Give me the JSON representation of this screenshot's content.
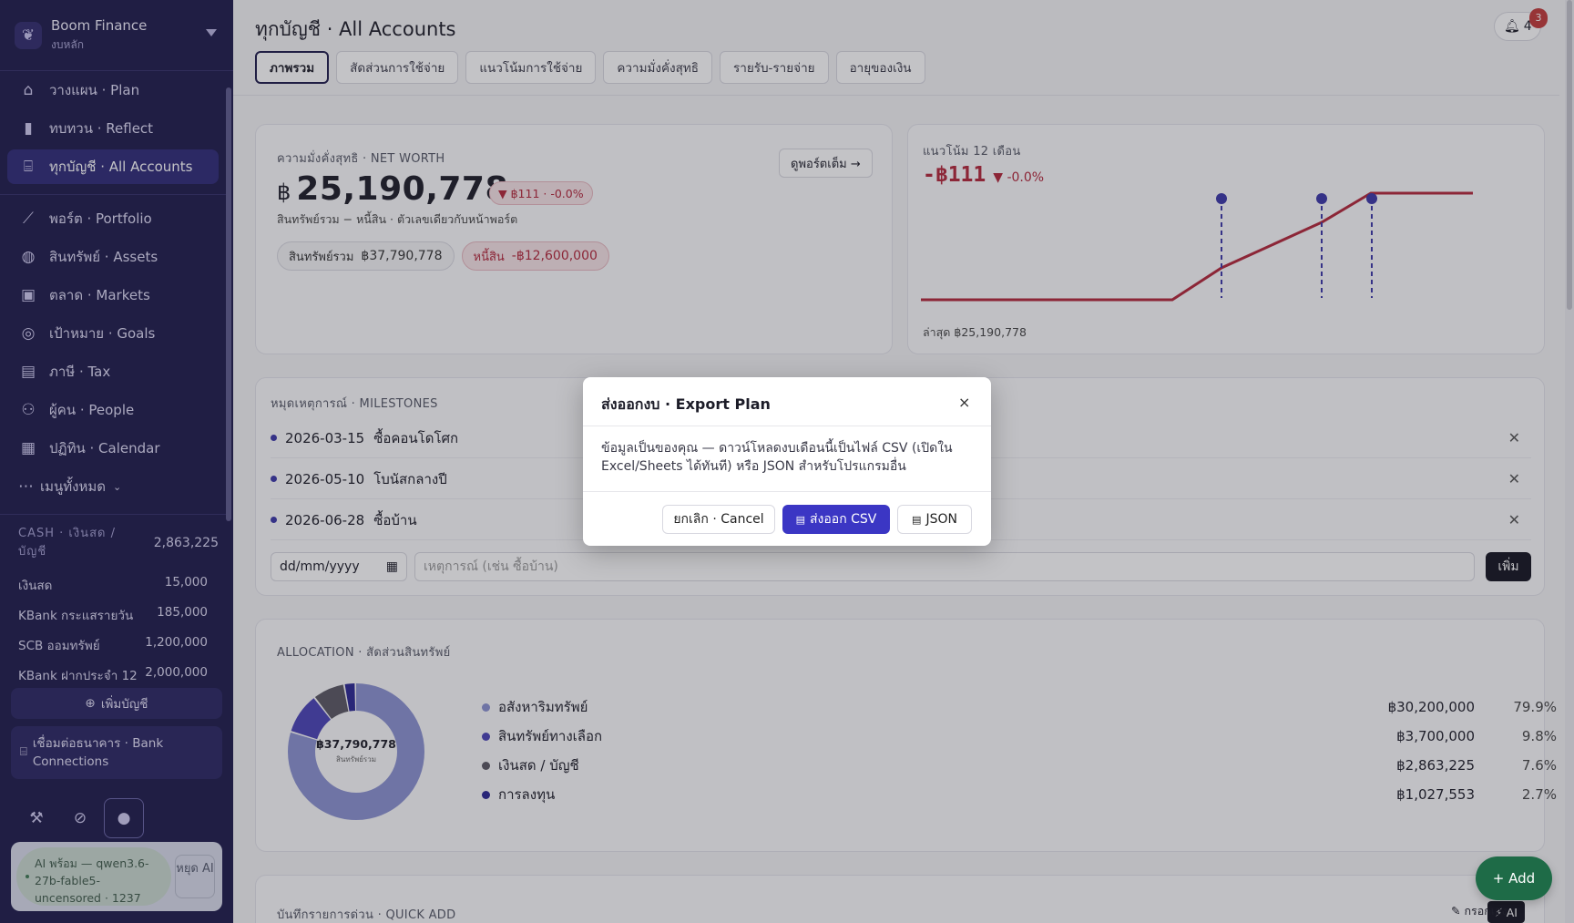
{
  "brand": {
    "name": "Boom Finance",
    "subtitle": "งบหลัก"
  },
  "nav": {
    "items": [
      {
        "icon": "plan-icon",
        "glyph": "⌂",
        "label": "วางแผน · Plan"
      },
      {
        "icon": "bar-chart-icon",
        "glyph": "▮",
        "label": "ทบทวน · Reflect"
      },
      {
        "icon": "bank-icon",
        "glyph": "⌸",
        "label": "ทุกบัญชี · All Accounts",
        "active": true
      },
      {
        "icon": "line-chart-icon",
        "glyph": "⟋",
        "label": "พอร์ต · Portfolio"
      },
      {
        "icon": "watch-icon",
        "glyph": "◍",
        "label": "สินทรัพย์ · Assets"
      },
      {
        "icon": "image-icon",
        "glyph": "▣",
        "label": "ตลาด · Markets"
      },
      {
        "icon": "target-icon",
        "glyph": "◎",
        "label": "เป้าหมาย · Goals"
      },
      {
        "icon": "document-icon",
        "glyph": "▤",
        "label": "ภาษี · Tax"
      },
      {
        "icon": "people-icon",
        "glyph": "⚇",
        "label": "ผู้คน · People"
      },
      {
        "icon": "calendar-icon",
        "glyph": "▦",
        "label": "ปฏิทิน · Calendar"
      }
    ],
    "all_menu": "เมนูทั้งหมด"
  },
  "cash": {
    "title": "CASH · เงินสด / บัญชี",
    "total": "2,863,225",
    "accounts": [
      {
        "name": "เงินสด",
        "amount": "15,000"
      },
      {
        "name": "KBank กระแสรายวัน",
        "amount": "185,000"
      },
      {
        "name": "SCB ออมทรัพย์",
        "amount": "1,200,000"
      },
      {
        "name": "KBank ฝากประจำ 12 เ...",
        "amount": "2,000,000"
      }
    ],
    "add_account": "เพิ่มบัญชี",
    "bank_connections": "เชื่อมต่อธนาคาร · Bank Connections"
  },
  "ai": {
    "status": "AI พร้อม — qwen3.6-27b-fable5-uncensored · 1237",
    "stop": "หยุด AI"
  },
  "header": {
    "title": "ทุกบัญชี · All Accounts",
    "bell_count": "4",
    "badge": "3"
  },
  "tabs": [
    "ภาพรวม",
    "สัดส่วนการใช้จ่าย",
    "แนวโน้มการใช้จ่าย",
    "ความมั่งคั่งสุทธิ",
    "รายรับ-รายจ่าย",
    "อายุของเงิน"
  ],
  "networth": {
    "label": "ความมั่งคั่งสุทธิ · NET WORTH",
    "view_portfolio": "ดูพอร์ตเต็ม →",
    "currency": "฿",
    "value": "25,190,778",
    "change": "▼ ฿111 · -0.0%",
    "note": "สินทรัพย์รวม − หนี้สิน · ตัวเลขเดียวกับหน้าพอร์ต",
    "assets_label": "สินทรัพย์รวม",
    "assets_value": "฿37,790,778",
    "debt_label": "หนี้สิน",
    "debt_value": "-฿12,600,000"
  },
  "trend": {
    "label": "แนวโน้ม 12 เดือน",
    "value": "-฿111",
    "change": "▼ -0.0%",
    "latest": "ล่าสุด ฿25,190,778"
  },
  "chart_data": {
    "type": "line",
    "title": "แนวโน้ม 12 เดือน",
    "points": 12,
    "series": [
      {
        "values": [
          null,
          null,
          null,
          null,
          null,
          null,
          null,
          null,
          null,
          null,
          null,
          25190778
        ]
      }
    ],
    "milestone_markers": 3,
    "colors": {
      "line": "#b3263a",
      "markers": "#3b36a8"
    }
  },
  "milestones": {
    "label": "หมุดเหตุการณ์ · MILESTONES",
    "items": [
      {
        "date": "2026-03-15",
        "name": "ซื้อคอนโดโศก"
      },
      {
        "date": "2026-05-10",
        "name": "โบนัสกลางปี"
      },
      {
        "date": "2026-06-28",
        "name": "ซื้อบ้าน"
      }
    ],
    "date_placeholder": "dd/mm/yyyy",
    "event_placeholder": "เหตุการณ์ (เช่น ซื้อบ้าน)",
    "add_button": "เพิ่ม"
  },
  "allocation": {
    "label": "ALLOCATION · สัดส่วนสินทรัพย์",
    "center_value": "฿37,790,778",
    "center_label": "สินทรัพย์รวม",
    "items": [
      {
        "name": "อสังหาริมทรัพย์",
        "value": "฿30,200,000",
        "pct": "79.9%",
        "color": "#8b92d1"
      },
      {
        "name": "สินทรัพย์ทางเลือก",
        "value": "฿3,700,000",
        "pct": "9.8%",
        "color": "#4a43b8"
      },
      {
        "name": "เงินสด / บัญชี",
        "value": "฿2,863,225",
        "pct": "7.6%",
        "color": "#5a5863"
      },
      {
        "name": "การลงทุน",
        "value": "฿1,027,553",
        "pct": "2.7%",
        "color": "#2a2694"
      }
    ]
  },
  "quick_add": {
    "label": "บันทึกรายการด่วน · QUICK ADD",
    "ai_button": "⚡ AI",
    "manual_button": "✎ กรอกเอง"
  },
  "fab": "+ Add",
  "modal": {
    "title": "ส่งออกงบ · Export Plan",
    "close": "×",
    "body": "ข้อมูลเป็นของคุณ — ดาวน์โหลดงบเดือนนี้เป็นไฟล์ CSV (เปิดใน Excel/Sheets ได้ทันที) หรือ JSON สำหรับโปรแกรมอื่น",
    "cancel": "ยกเลิก · Cancel",
    "csv": "ส่งออก CSV",
    "json": "JSON"
  }
}
